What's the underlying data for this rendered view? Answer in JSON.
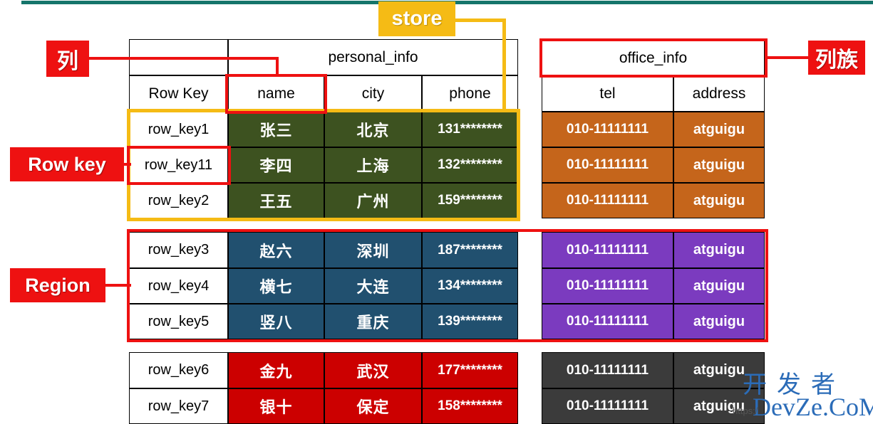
{
  "diagram": {
    "title_watermark_cn": "开发者",
    "title_watermark_en": "DevZe.CoM",
    "watermark_url": "https:/",
    "annotations": {
      "column": "列",
      "row_key": "Row key",
      "region": "Region",
      "column_family": "列族",
      "store": "store"
    },
    "colors": {
      "red": "#ee1111",
      "yellow": "#f5bb15",
      "green": "#3d5220",
      "orange": "#c5651b",
      "blue": "#21506f",
      "purple": "#7b3bbf",
      "crimson": "#cc0000",
      "darkgray": "#3b3b3b",
      "teal": "#15756b"
    }
  },
  "left_table": {
    "family_blank": "",
    "family_name": "personal_info",
    "headers": [
      "Row Key",
      "name",
      "city",
      "phone"
    ],
    "blocks": [
      {
        "fill": "#3d5220",
        "rows": [
          {
            "key": "row_key1",
            "name": "张三",
            "city": "北京",
            "phone": "131********"
          },
          {
            "key": "row_key11",
            "name": "李四",
            "city": "上海",
            "phone": "132********"
          },
          {
            "key": "row_key2",
            "name": "王五",
            "city": "广州",
            "phone": "159********"
          }
        ]
      },
      {
        "fill": "#21506f",
        "rows": [
          {
            "key": "row_key3",
            "name": "赵六",
            "city": "深圳",
            "phone": "187********"
          },
          {
            "key": "row_key4",
            "name": "横七",
            "city": "大连",
            "phone": "134********"
          },
          {
            "key": "row_key5",
            "name": "竖八",
            "city": "重庆",
            "phone": "139********"
          }
        ]
      },
      {
        "fill": "#cc0000",
        "rows": [
          {
            "key": "row_key6",
            "name": "金九",
            "city": "武汉",
            "phone": "177********"
          },
          {
            "key": "row_key7",
            "name": "银十",
            "city": "保定",
            "phone": "158********"
          }
        ]
      }
    ]
  },
  "right_table": {
    "family_name": "office_info",
    "headers": [
      "tel",
      "address"
    ],
    "blocks": [
      {
        "fill": "#c5651b",
        "rows": [
          {
            "tel": "010-11111111",
            "address": "atguigu"
          },
          {
            "tel": "010-11111111",
            "address": "atguigu"
          },
          {
            "tel": "010-11111111",
            "address": "atguigu"
          }
        ]
      },
      {
        "fill": "#7b3bbf",
        "rows": [
          {
            "tel": "010-11111111",
            "address": "atguigu"
          },
          {
            "tel": "010-11111111",
            "address": "atguigu"
          },
          {
            "tel": "010-11111111",
            "address": "atguigu"
          }
        ]
      },
      {
        "fill": "#3b3b3b",
        "rows": [
          {
            "tel": "010-11111111",
            "address": "atguigu"
          },
          {
            "tel": "010-11111111",
            "address": "atguigu"
          }
        ]
      }
    ]
  }
}
